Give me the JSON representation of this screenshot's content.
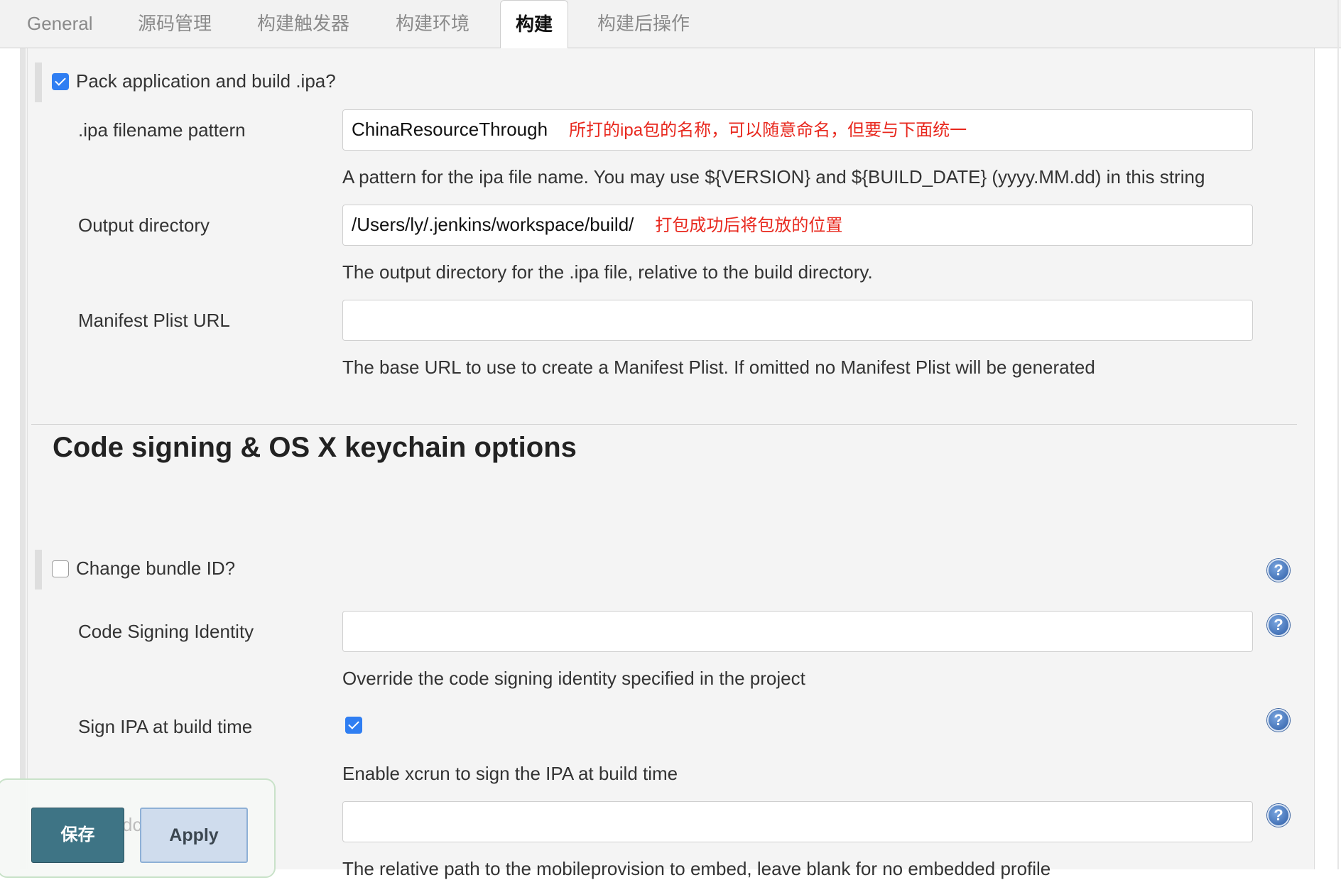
{
  "tabs": [
    {
      "label": "General"
    },
    {
      "label": "源码管理"
    },
    {
      "label": "构建触发器"
    },
    {
      "label": "构建环境"
    },
    {
      "label": "构建"
    },
    {
      "label": "构建后操作"
    }
  ],
  "active_tab": "构建",
  "pack": {
    "label": "Pack application and build .ipa?",
    "checked": true
  },
  "ipa_filename": {
    "label": ".ipa filename pattern",
    "value": "ChinaResourceThrough",
    "note": "所打的ipa包的名称，可以随意命名，但要与下面统一",
    "description": "A pattern for the ipa file name. You may use ${VERSION} and ${BUILD_DATE} (yyyy.MM.dd) in this string"
  },
  "output_dir": {
    "label": "Output directory",
    "value": "/Users/ly/.jenkins/workspace/build/",
    "note": "打包成功后将包放的位置",
    "description": "The output directory for the .ipa file, relative to the build directory."
  },
  "manifest": {
    "label": "Manifest Plist URL",
    "value": "",
    "description": "The base URL to use to create a Manifest Plist. If omitted no Manifest Plist will be generated"
  },
  "section": {
    "title": "Code signing & OS X keychain options"
  },
  "change_bundle": {
    "label": "Change bundle ID?",
    "checked": false
  },
  "signing_identity": {
    "label": "Code Signing Identity",
    "value": "",
    "description": "Override the code signing identity specified in the project"
  },
  "sign_ipa": {
    "label": "Sign IPA at build time",
    "checked": true,
    "description": "Enable xcrun to sign the IPA at build time"
  },
  "mobileprovision": {
    "value": "",
    "description": "The relative path to the mobileprovision to embed, leave blank for no embedded profile"
  },
  "help_icon": {
    "glyph": "?"
  },
  "buttons": {
    "save": "保存",
    "apply": "Apply"
  },
  "hidden_fragment": "dc",
  "colors": {
    "checkbox_accent": "#2f7ef2",
    "note_red": "#e8281e",
    "save_button": "#3e7485",
    "apply_button": "#cfdced"
  }
}
